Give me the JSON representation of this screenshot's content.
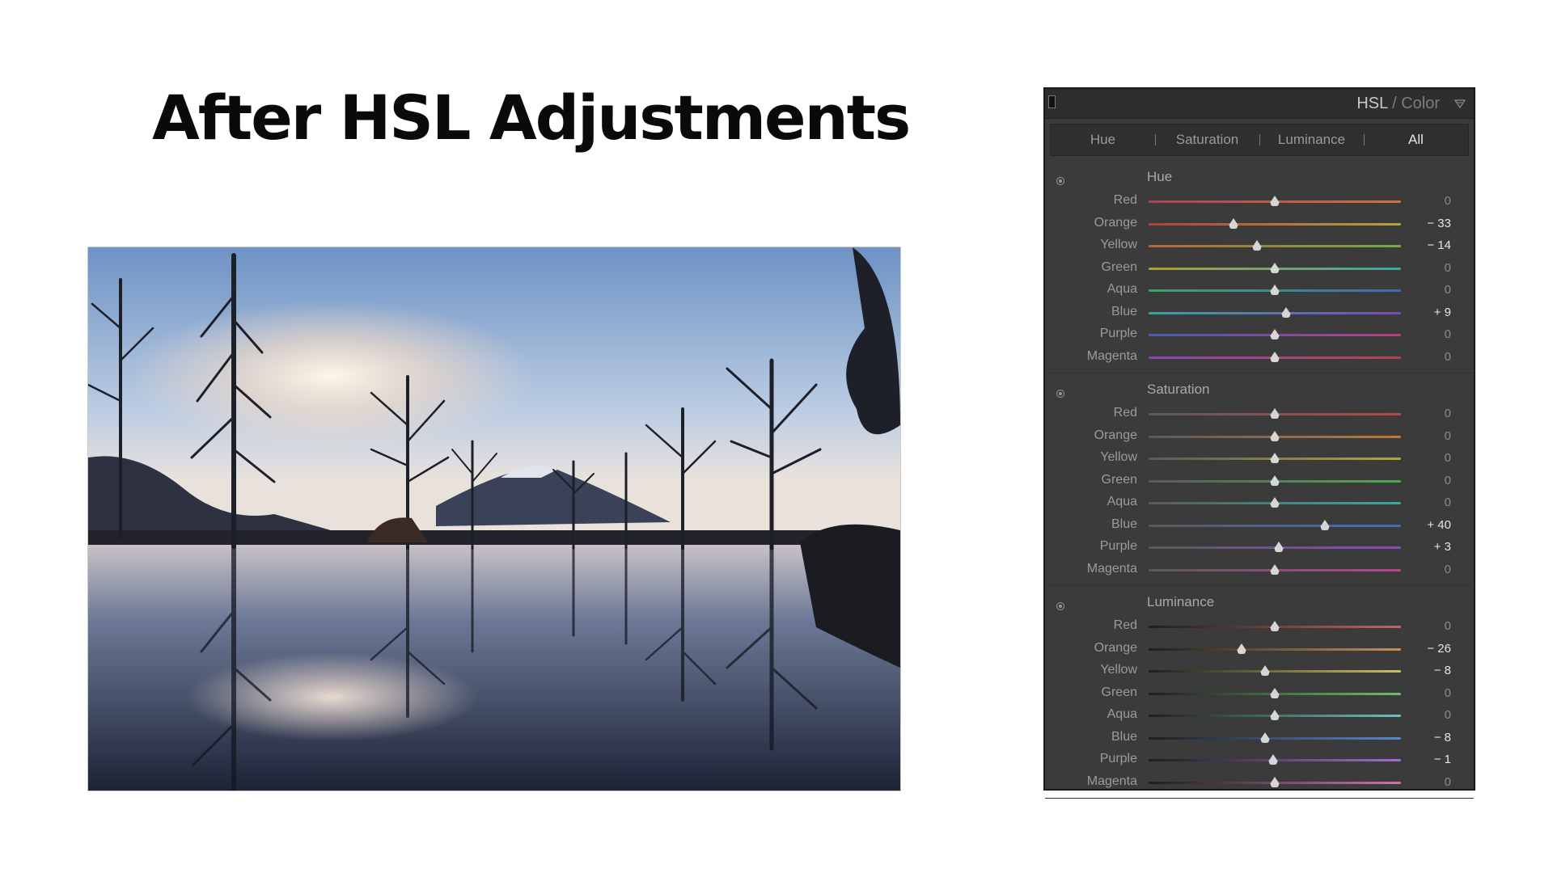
{
  "slide_title": "After HSL Adjustments",
  "panel": {
    "title_main": "HSL",
    "title_sep": "/",
    "title_alt": "Color",
    "tabs": [
      {
        "label": "Hue",
        "active": false
      },
      {
        "label": "Saturation",
        "active": false
      },
      {
        "label": "Luminance",
        "active": false
      },
      {
        "label": "All",
        "active": true
      }
    ],
    "sections": [
      {
        "title": "Hue",
        "type": "hue",
        "rows": [
          {
            "label": "Red",
            "value": "0",
            "amount": 0
          },
          {
            "label": "Orange",
            "value": "− 33",
            "amount": -33
          },
          {
            "label": "Yellow",
            "value": "− 14",
            "amount": -14
          },
          {
            "label": "Green",
            "value": "0",
            "amount": 0
          },
          {
            "label": "Aqua",
            "value": "0",
            "amount": 0
          },
          {
            "label": "Blue",
            "value": "+ 9",
            "amount": 9
          },
          {
            "label": "Purple",
            "value": "0",
            "amount": 0
          },
          {
            "label": "Magenta",
            "value": "0",
            "amount": 0
          }
        ]
      },
      {
        "title": "Saturation",
        "type": "sat",
        "rows": [
          {
            "label": "Red",
            "value": "0",
            "amount": 0
          },
          {
            "label": "Orange",
            "value": "0",
            "amount": 0
          },
          {
            "label": "Yellow",
            "value": "0",
            "amount": 0
          },
          {
            "label": "Green",
            "value": "0",
            "amount": 0
          },
          {
            "label": "Aqua",
            "value": "0",
            "amount": 0
          },
          {
            "label": "Blue",
            "value": "+ 40",
            "amount": 40
          },
          {
            "label": "Purple",
            "value": "+ 3",
            "amount": 3
          },
          {
            "label": "Magenta",
            "value": "0",
            "amount": 0
          }
        ]
      },
      {
        "title": "Luminance",
        "type": "lum",
        "rows": [
          {
            "label": "Red",
            "value": "0",
            "amount": 0
          },
          {
            "label": "Orange",
            "value": "− 26",
            "amount": -26
          },
          {
            "label": "Yellow",
            "value": "− 8",
            "amount": -8
          },
          {
            "label": "Green",
            "value": "0",
            "amount": 0
          },
          {
            "label": "Aqua",
            "value": "0",
            "amount": 0
          },
          {
            "label": "Blue",
            "value": "− 8",
            "amount": -8
          },
          {
            "label": "Purple",
            "value": "− 1",
            "amount": -1
          },
          {
            "label": "Magenta",
            "value": "0",
            "amount": 0
          }
        ]
      }
    ],
    "colors": {
      "hue": [
        "#b0405a,#c9753d",
        "#b2403a,#b5a43a",
        "#b8663a,#6fae3c",
        "#a9a23a,#3fa5a2",
        "#3aa46a,#3f6cb5",
        "#3aa1a4,#7a4ab5",
        "#4a5ab5,#b4407f",
        "#8a46b5,#b9404a"
      ],
      "sat": [
        "#5a5a5a,#b84848",
        "#5a5a5a,#c0783c",
        "#5a5a5a,#b3a53c",
        "#5a5a5a,#4faa4a",
        "#5a5a5a,#3ea6a0",
        "#5a5a5a,#3f6fbf",
        "#5a5a5a,#8a4abf",
        "#5a5a5a,#b54590"
      ],
      "lum": [
        "#1e1e1e,#c46464",
        "#1e1e1e,#c8905a",
        "#1e1e1e,#c9c06a",
        "#1e1e1e,#6cc06a",
        "#1e1e1e,#6ac2bc",
        "#1e1e1e,#5a86d0",
        "#1e1e1e,#a66ad0",
        "#1e1e1e,#d070b0"
      ]
    }
  }
}
